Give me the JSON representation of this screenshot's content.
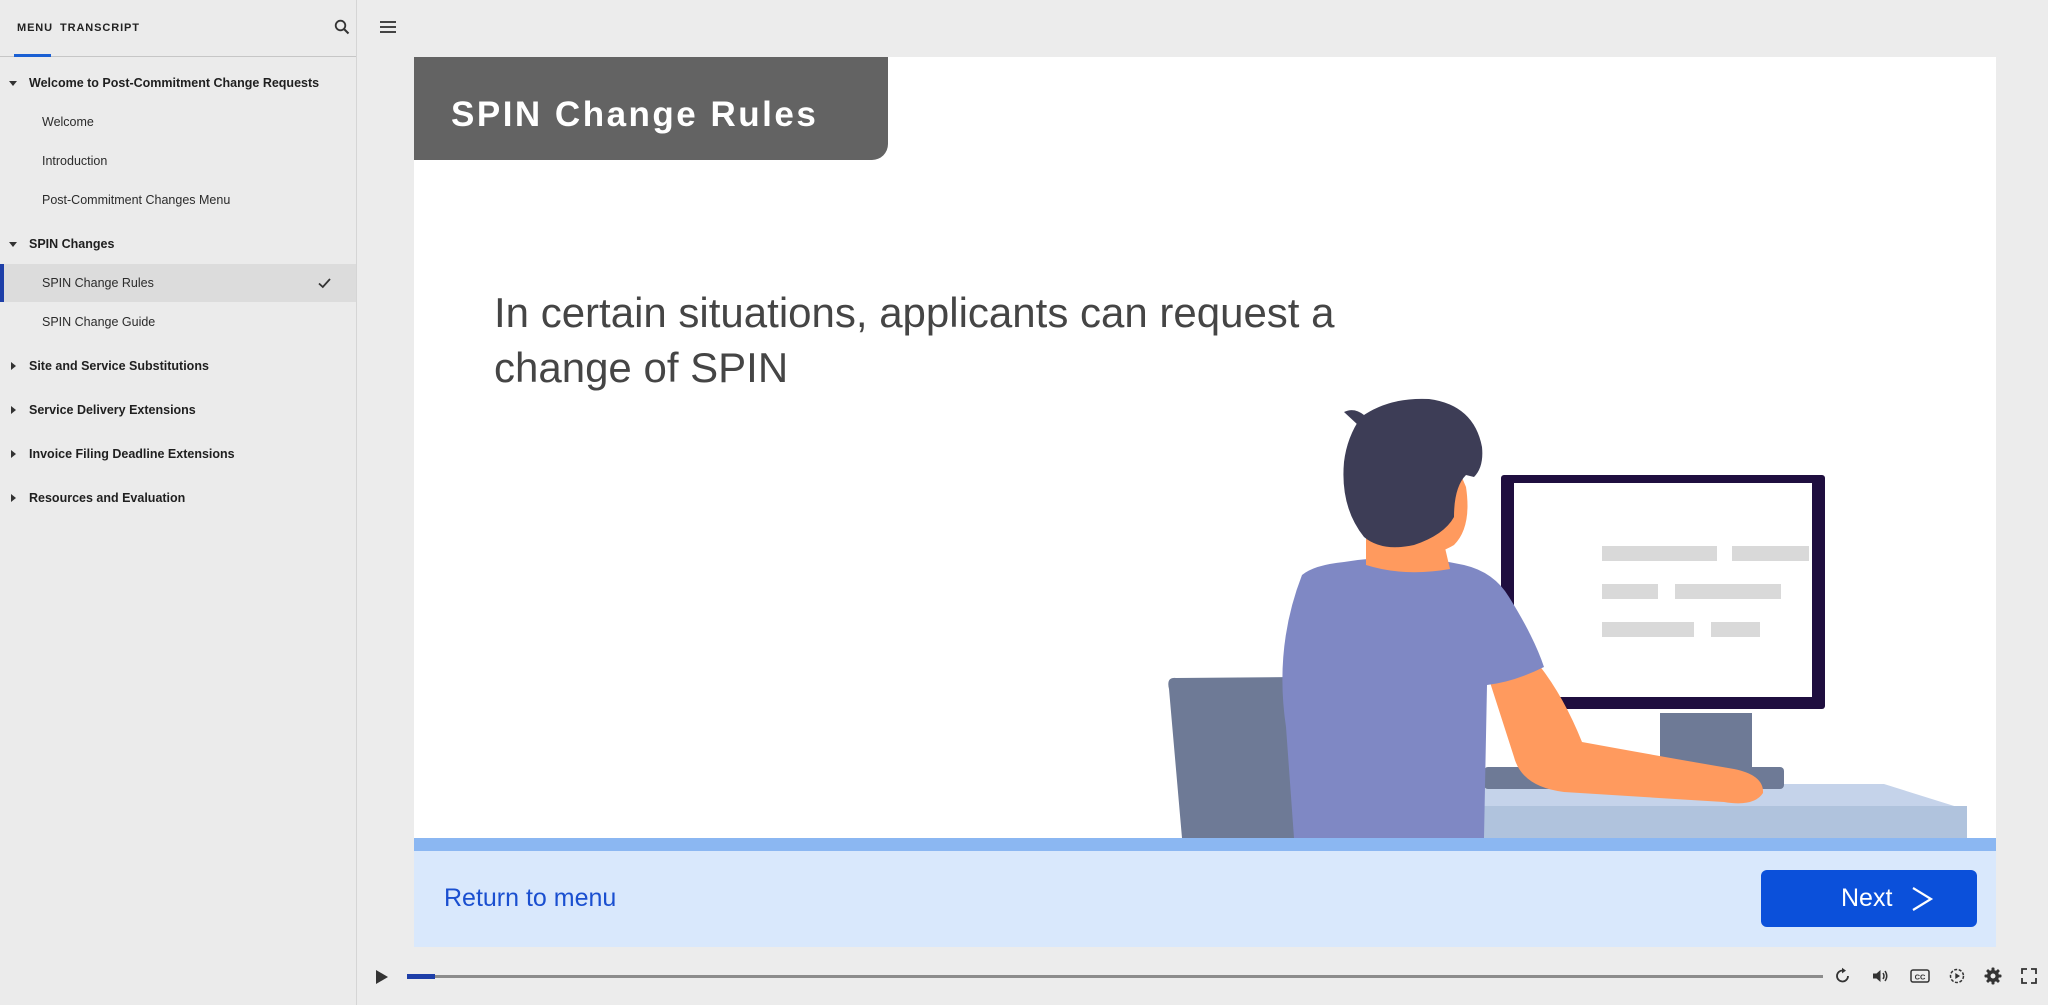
{
  "sidebar": {
    "tabs": {
      "menu": "MENU",
      "transcript": "TRANSCRIPT"
    },
    "items": [
      {
        "label": "Welcome to Post-Commitment Change Requests",
        "type": "section",
        "expanded": true
      },
      {
        "label": "Welcome",
        "type": "child"
      },
      {
        "label": "Introduction",
        "type": "child"
      },
      {
        "label": "Post-Commitment Changes Menu",
        "type": "child"
      },
      {
        "label": "SPIN Changes",
        "type": "section",
        "expanded": true
      },
      {
        "label": "SPIN Change Rules",
        "type": "child",
        "active": true,
        "completed": true
      },
      {
        "label": "SPIN Change Guide",
        "type": "child"
      },
      {
        "label": "Site and Service Substitutions",
        "type": "section",
        "expanded": false
      },
      {
        "label": "Service Delivery Extensions",
        "type": "section",
        "expanded": false
      },
      {
        "label": "Invoice Filing Deadline Extensions",
        "type": "section",
        "expanded": false
      },
      {
        "label": "Resources and Evaluation",
        "type": "section",
        "expanded": false
      }
    ]
  },
  "slide": {
    "title": "SPIN Change Rules",
    "body": "In certain situations, applicants can request a change of SPIN",
    "return_link": "Return to menu",
    "next_label": "Next"
  },
  "player": {
    "progress": 0.02
  },
  "icons": {
    "search": "search-icon",
    "hamburger": "hamburger-menu-icon",
    "play": "play-icon",
    "replay": "replay-icon",
    "volume": "volume-icon",
    "captions": "closed-captions-icon",
    "speed": "playback-speed-icon",
    "settings": "gear-icon",
    "fullscreen": "fullscreen-icon"
  },
  "colors": {
    "accent": "#0b50da",
    "title_bg": "#636363",
    "bottom_bar": "#d9e8fc",
    "bottom_strip": "#8bb7f2",
    "active_marker": "#1e3fa8"
  }
}
